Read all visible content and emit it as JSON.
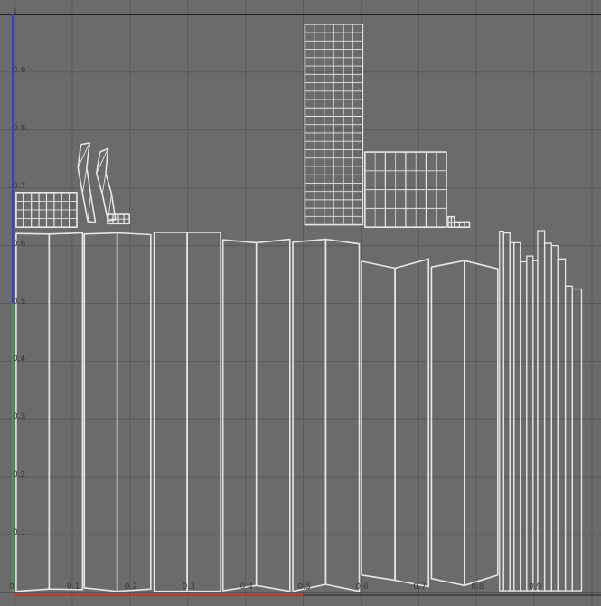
{
  "editor": {
    "panel_name": "UV Editor viewport",
    "colors": {
      "background": "#6b6b6b",
      "grid": "#5a5a5a",
      "grid_major": "#3c3c3c",
      "wire": "#e6e6e6",
      "u_axis": "#c0392b",
      "v_axis_lower": "#3ea34a",
      "v_axis_upper": "#3a3fd0",
      "top_border": "#222222"
    }
  },
  "axes": {
    "v_ticks": [
      {
        "value": 1,
        "label": "1"
      },
      {
        "value": 0.9,
        "label": "0.9"
      },
      {
        "value": 0.8,
        "label": "0.8"
      },
      {
        "value": 0.7,
        "label": "0.7"
      },
      {
        "value": 0.6,
        "label": "0.6"
      },
      {
        "value": 0.5,
        "label": "0.5"
      },
      {
        "value": 0.4,
        "label": "0.4"
      },
      {
        "value": 0.3,
        "label": "0.3"
      },
      {
        "value": 0.2,
        "label": "0.2"
      },
      {
        "value": 0.1,
        "label": "0.1"
      }
    ],
    "u_ticks": [
      {
        "value": 0,
        "label": "0"
      },
      {
        "value": 0.1,
        "label": "0.1"
      },
      {
        "value": 0.2,
        "label": "0.2"
      },
      {
        "value": 0.3,
        "label": "0.3"
      },
      {
        "value": 0.4,
        "label": "0.4"
      },
      {
        "value": 0.5,
        "label": "0.5"
      },
      {
        "value": 0.6,
        "label": "0.6"
      },
      {
        "value": 0.7,
        "label": "0.7"
      },
      {
        "value": 0.8,
        "label": "0.8"
      },
      {
        "value": 0.9,
        "label": "0.9"
      }
    ],
    "u_axis_highlight_range": [
      0,
      0.5
    ],
    "v_axis_highlight_range": [
      0,
      0.5
    ],
    "v_axis_upper_range": [
      0.5,
      1.0
    ]
  },
  "uv_shells": {
    "big_panels": [
      {
        "u0": 0.003,
        "u1": 0.06,
        "top0": 0.621,
        "top1": 0.62,
        "bot0": 0.002,
        "bot1": 0.006,
        "cols": 1
      },
      {
        "u0": 0.06,
        "u1": 0.118,
        "top0": 0.62,
        "top1": 0.622,
        "bot0": 0.006,
        "bot1": 0.005,
        "cols": 1
      },
      {
        "u0": 0.121,
        "u1": 0.178,
        "top0": 0.62,
        "top1": 0.622,
        "bot0": 0.008,
        "bot1": 0.002,
        "cols": 1
      },
      {
        "u0": 0.178,
        "u1": 0.236,
        "top0": 0.622,
        "top1": 0.619,
        "bot0": 0.002,
        "bot1": 0.006,
        "cols": 1
      },
      {
        "u0": 0.242,
        "u1": 0.299,
        "top0": 0.623,
        "top1": 0.623,
        "bot0": 0.002,
        "bot1": 0.002,
        "cols": 1
      },
      {
        "u0": 0.299,
        "u1": 0.357,
        "top0": 0.623,
        "top1": 0.623,
        "bot0": 0.002,
        "bot1": 0.002,
        "cols": 1
      },
      {
        "u0": 0.361,
        "u1": 0.419,
        "top0": 0.61,
        "top1": 0.605,
        "bot0": 0.003,
        "bot1": 0.012,
        "cols": 1
      },
      {
        "u0": 0.419,
        "u1": 0.477,
        "top0": 0.605,
        "top1": 0.611,
        "bot0": 0.012,
        "bot1": 0.002,
        "cols": 1
      },
      {
        "u0": 0.482,
        "u1": 0.539,
        "top0": 0.606,
        "top1": 0.611,
        "bot0": 0.002,
        "bot1": 0.014,
        "cols": 1
      },
      {
        "u0": 0.539,
        "u1": 0.597,
        "top0": 0.611,
        "top1": 0.603,
        "bot0": 0.014,
        "bot1": 0.002,
        "cols": 1
      },
      {
        "u0": 0.601,
        "u1": 0.659,
        "top0": 0.573,
        "top1": 0.561,
        "bot0": 0.03,
        "bot1": 0.021,
        "cols": 1
      },
      {
        "u0": 0.659,
        "u1": 0.717,
        "top0": 0.561,
        "top1": 0.577,
        "bot0": 0.021,
        "bot1": 0.01,
        "cols": 1
      },
      {
        "u0": 0.722,
        "u1": 0.779,
        "top0": 0.563,
        "top1": 0.574,
        "bot0": 0.024,
        "bot1": 0.012,
        "cols": 1
      },
      {
        "u0": 0.779,
        "u1": 0.837,
        "top0": 0.574,
        "top1": 0.56,
        "bot0": 0.012,
        "bot1": 0.03,
        "cols": 1
      }
    ],
    "strips": [
      {
        "u0": 0.84,
        "u1": 0.847,
        "top": 0.625,
        "bot": 0.003
      },
      {
        "u0": 0.847,
        "u1": 0.858,
        "top": 0.622,
        "bot": 0.003
      },
      {
        "u0": 0.858,
        "u1": 0.865,
        "top": 0.605,
        "bot": 0.003
      },
      {
        "u0": 0.865,
        "u1": 0.876,
        "top": 0.605,
        "bot": 0.003
      },
      {
        "u0": 0.876,
        "u1": 0.887,
        "top": 0.572,
        "bot": 0.003
      },
      {
        "u0": 0.887,
        "u1": 0.898,
        "top": 0.582,
        "bot": 0.003
      },
      {
        "u0": 0.898,
        "u1": 0.906,
        "top": 0.574,
        "bot": 0.003
      },
      {
        "u0": 0.906,
        "u1": 0.918,
        "top": 0.626,
        "bot": 0.003
      },
      {
        "u0": 0.918,
        "u1": 0.93,
        "top": 0.604,
        "bot": 0.003
      },
      {
        "u0": 0.93,
        "u1": 0.941,
        "top": 0.6,
        "bot": 0.003
      },
      {
        "u0": 0.941,
        "u1": 0.954,
        "top": 0.577,
        "bot": 0.003
      },
      {
        "u0": 0.954,
        "u1": 0.966,
        "top": 0.53,
        "bot": 0.003
      },
      {
        "u0": 0.966,
        "u1": 0.982,
        "top": 0.525,
        "bot": 0.003
      }
    ],
    "tall_tower": {
      "u0": 0.503,
      "u1": 0.603,
      "v0": 0.636,
      "v1": 0.983,
      "cols": 3,
      "rows": 24
    },
    "block_group": {
      "u0": 0.607,
      "u1": 0.748,
      "v0": 0.632,
      "v1": 0.762,
      "cols": 4,
      "rows": 4
    },
    "small_pieces": [
      {
        "u0": 0.003,
        "u1": 0.108,
        "v0": 0.632,
        "v1": 0.692,
        "cols": 8,
        "rows": 4
      },
      {
        "u0": 0.161,
        "u1": 0.199,
        "v0": 0.638,
        "v1": 0.654,
        "cols": 4,
        "rows": 2
      },
      {
        "u0": 0.751,
        "u1": 0.762,
        "v0": 0.632,
        "v1": 0.65,
        "cols": 2,
        "rows": 2
      },
      {
        "u0": 0.762,
        "u1": 0.788,
        "v0": 0.632,
        "v1": 0.641,
        "cols": 3,
        "rows": 1
      }
    ],
    "curved_pieces": [
      {
        "path": [
          [
            0.115,
            0.775
          ],
          [
            0.13,
            0.778
          ],
          [
            0.125,
            0.735
          ],
          [
            0.132,
            0.69
          ],
          [
            0.14,
            0.64
          ],
          [
            0.127,
            0.642
          ],
          [
            0.118,
            0.69
          ],
          [
            0.11,
            0.735
          ],
          [
            0.115,
            0.775
          ]
        ]
      },
      {
        "path": [
          [
            0.148,
            0.762
          ],
          [
            0.162,
            0.768
          ],
          [
            0.158,
            0.725
          ],
          [
            0.168,
            0.69
          ],
          [
            0.175,
            0.645
          ],
          [
            0.162,
            0.643
          ],
          [
            0.152,
            0.69
          ],
          [
            0.142,
            0.725
          ],
          [
            0.148,
            0.762
          ]
        ]
      }
    ]
  }
}
